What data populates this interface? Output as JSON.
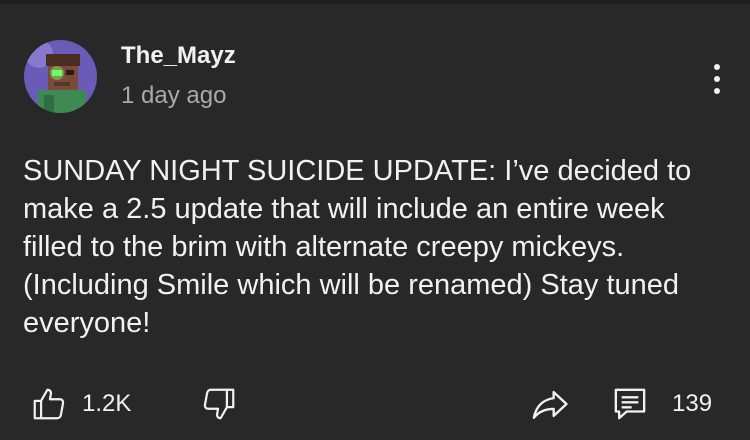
{
  "author": {
    "name": "The_Mayz",
    "timestamp": "1 day ago",
    "avatar_icon": "pixel-character-avatar"
  },
  "post": {
    "text": "SUNDAY NIGHT SUICIDE UPDATE: I’ve decided to make a 2.5 update that will include an entire week filled to the brim with alternate creepy mickeys. (Including Smile which will be renamed) Stay tuned everyone!"
  },
  "actions": {
    "like_count": "1.2K",
    "comment_count": "139",
    "like_icon": "thumbs-up-icon",
    "dislike_icon": "thumbs-down-icon",
    "share_icon": "share-arrow-icon",
    "comment_icon": "comment-icon",
    "more_icon": "more-vertical-icon"
  },
  "colors": {
    "background": "#282828",
    "primary_text": "#f1f1f1",
    "secondary_text": "#aaaaaa"
  }
}
